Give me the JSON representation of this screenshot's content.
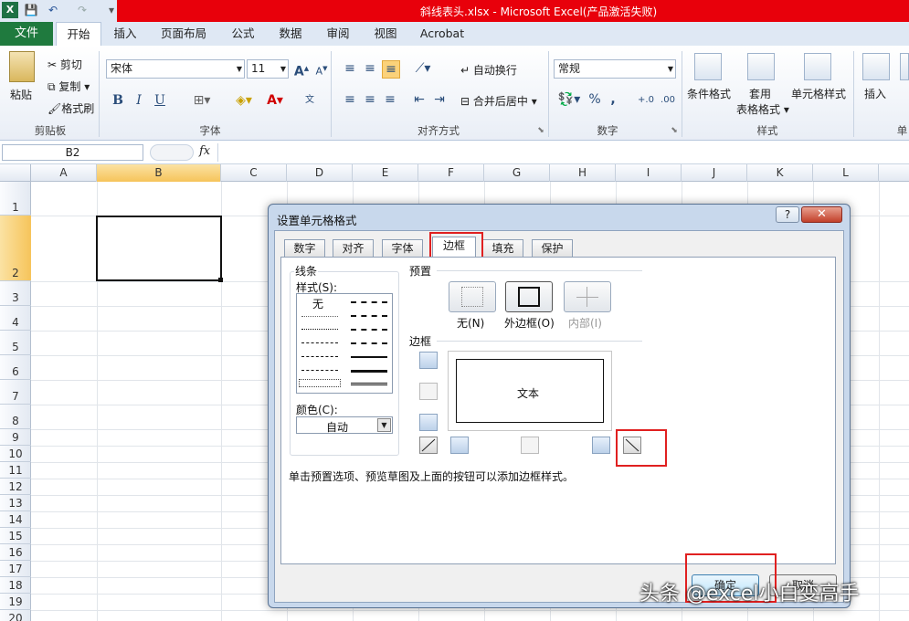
{
  "titlebar": {
    "title": "斜线表头.xlsx  -  Microsoft Excel(产品激活失败)",
    "app_icon": "X"
  },
  "tabs": {
    "file": "文件",
    "items": [
      "开始",
      "插入",
      "页面布局",
      "公式",
      "数据",
      "审阅",
      "视图",
      "Acrobat"
    ]
  },
  "ribbon": {
    "clipboard": {
      "paste": "粘贴",
      "cut": "剪切",
      "copy": "复制",
      "format_painter": "格式刷",
      "group": "剪贴板"
    },
    "font": {
      "name": "宋体",
      "size": "11",
      "group": "字体"
    },
    "alignment": {
      "wrap": "自动换行",
      "merge": "合并后居中",
      "group": "对齐方式"
    },
    "number": {
      "format": "常规",
      "group": "数字"
    },
    "styles": {
      "conditional": "条件格式",
      "table": "套用",
      "table2": "表格格式",
      "cell": "单元格样式",
      "group": "样式"
    },
    "cells": {
      "insert": "插入",
      "group": "单"
    }
  },
  "formula_bar": {
    "name_box": "B2",
    "fx": "fx"
  },
  "grid": {
    "columns": [
      "A",
      "B",
      "C",
      "D",
      "E",
      "F",
      "G",
      "H",
      "I",
      "J",
      "K",
      "L"
    ],
    "rows": [
      "1",
      "2",
      "3",
      "4",
      "5",
      "6",
      "7",
      "8",
      "9",
      "10",
      "11",
      "12",
      "13",
      "14",
      "15",
      "16",
      "17",
      "18",
      "19",
      "20"
    ]
  },
  "dialog": {
    "title": "设置单元格格式",
    "help": "?",
    "close": "✕",
    "tabs": [
      "数字",
      "对齐",
      "字体",
      "边框",
      "填充",
      "保护"
    ],
    "line_section": "线条",
    "style_label": "样式(S):",
    "none_style": "无",
    "color_label": "颜色(C):",
    "color_value": "自动",
    "preset_section": "预置",
    "preset_none": "无(N)",
    "preset_outline": "外边框(O)",
    "preset_inside": "内部(I)",
    "border_section": "边框",
    "preview_text": "文本",
    "hint": "单击预置选项、预览草图及上面的按钮可以添加边框样式。",
    "ok": "确定",
    "cancel": "取消"
  },
  "watermark": "头条 @excel小白变高手",
  "colors": {
    "title_red": "#e8000b",
    "file_tab": "#1f7a3e",
    "highlight": "#e02020"
  }
}
